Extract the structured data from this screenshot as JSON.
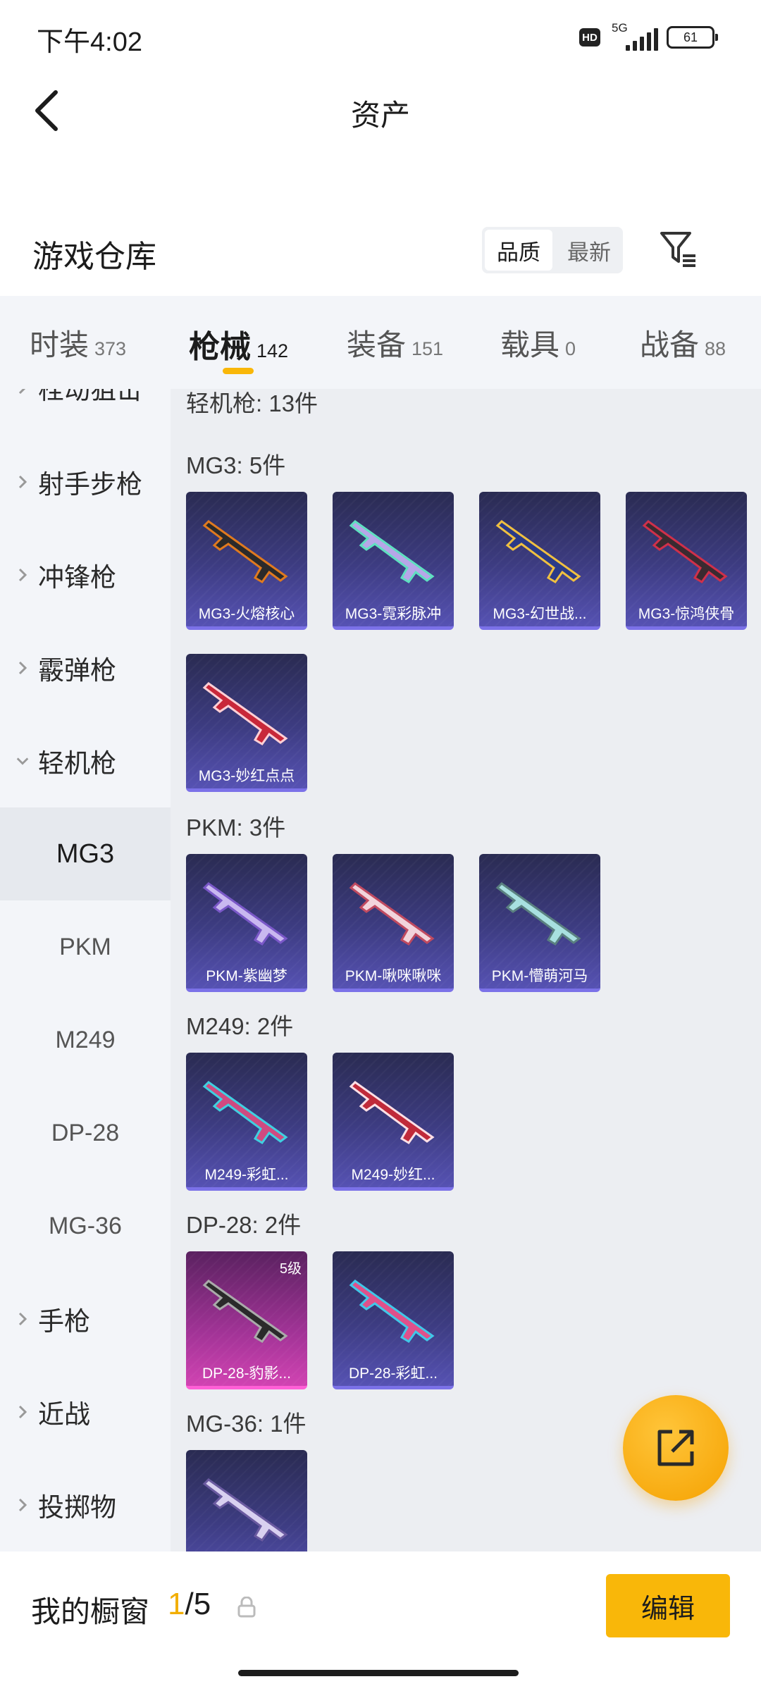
{
  "status_bar": {
    "time": "下午4:02",
    "hd": "HD",
    "network": "5G",
    "battery": "61"
  },
  "header": {
    "title": "资产"
  },
  "warehouse": {
    "title": "游戏仓库",
    "sort_options": [
      "品质",
      "最新"
    ],
    "active_sort": "品质"
  },
  "tabs": [
    {
      "label": "时装",
      "count": "373"
    },
    {
      "label": "枪械",
      "count": "142",
      "active": true
    },
    {
      "label": "装备",
      "count": "151"
    },
    {
      "label": "载具",
      "count": "0"
    },
    {
      "label": "战备",
      "count": "88"
    }
  ],
  "sidebar": {
    "partial_top": "栓动狙击",
    "categories": [
      "射手步枪",
      "冲锋枪",
      "霰弹枪",
      "轻机枪"
    ],
    "expanded_category": "轻机枪",
    "subcategories": [
      "MG3",
      "PKM",
      "M249",
      "DP-28",
      "MG-36"
    ],
    "active_sub": "MG3",
    "more_categories": [
      "手枪",
      "近战",
      "投掷物"
    ]
  },
  "content": {
    "category_header": "轻机枪: 13件",
    "groups": [
      {
        "title": "MG3: 5件",
        "items": [
          "MG3-火熔核心",
          "MG3-霓彩脉冲",
          "MG3-幻世战...",
          "MG3-惊鸿侠骨",
          "MG3-妙红点点"
        ]
      },
      {
        "title": "PKM: 3件",
        "items": [
          "PKM-紫幽梦",
          "PKM-啾咪啾咪",
          "PKM-懵萌河马"
        ]
      },
      {
        "title": "M249: 2件",
        "items": [
          "M249-彩虹...",
          "M249-妙红..."
        ]
      },
      {
        "title": "DP-28: 2件",
        "items": [
          "DP-28-豹影...",
          "DP-28-彩虹..."
        ],
        "badge": "5级"
      },
      {
        "title": "MG-36: 1件",
        "items": [
          ""
        ]
      }
    ]
  },
  "bottom_bar": {
    "showcase_label": "我的橱窗",
    "showcase_current": "1",
    "showcase_total": "/5",
    "edit_label": "编辑"
  },
  "colors": {
    "accent": "#f9b709",
    "card_purple": "#3d3c82",
    "card_pink": "#a13396"
  }
}
